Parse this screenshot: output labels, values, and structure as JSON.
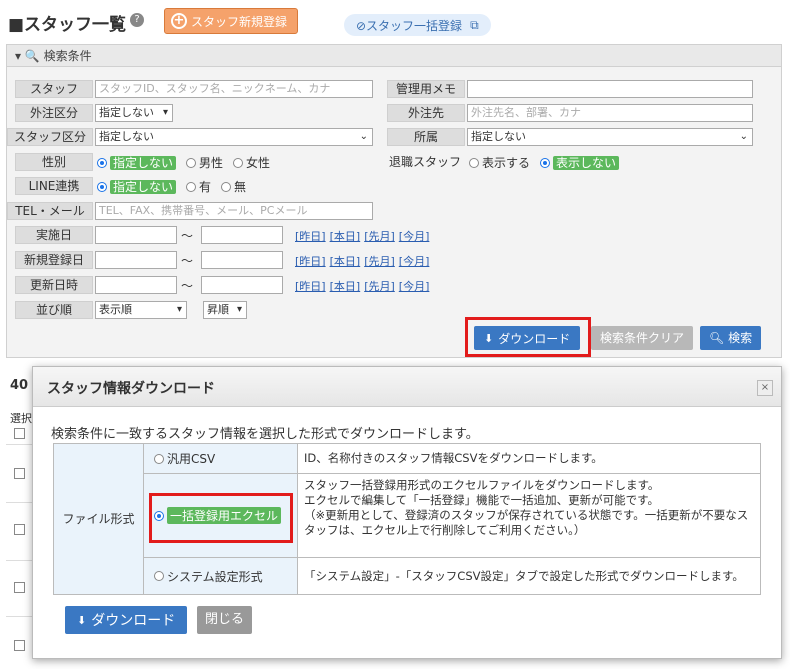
{
  "header": {
    "title": "■スタッフ一覧",
    "help": "?",
    "new_button": "スタッフ新規登録",
    "bulk_button": "⊘スタッフ一括登録"
  },
  "search": {
    "title": "▾ 🔍 検索条件",
    "labels": {
      "staff": "スタッフ",
      "memo": "管理用メモ",
      "outsource_type": "外注区分",
      "outsource_to": "外注先",
      "staff_type": "スタッフ区分",
      "affiliation": "所属",
      "gender": "性別",
      "retired": "退職スタッフ",
      "line": "LINE連携",
      "tel": "TEL・メール",
      "exec_date": "実施日",
      "reg_date": "新規登録日",
      "upd_date": "更新日時",
      "order": "並び順"
    },
    "placeholders": {
      "staff": "スタッフID、スタッフ名、ニックネーム、カナ",
      "outsource_to": "外注先名、部署、カナ",
      "tel": "TEL、FAX、携帯番号、メール、PCメール"
    },
    "values": {
      "outsource_type": "指定しない",
      "staff_type": "指定しない",
      "affiliation": "指定しない",
      "order": "表示順",
      "direction": "昇順"
    },
    "gender_options": [
      "指定しない",
      "男性",
      "女性"
    ],
    "retired_options": [
      "表示する",
      "表示しない"
    ],
    "line_options": [
      "指定しない",
      "有",
      "無"
    ],
    "tilde": "〜",
    "date_links": [
      "[昨日]",
      "[本日]",
      "[先月]",
      "[今月]"
    ],
    "download": "ダウンロード",
    "clear": "検索条件クリア",
    "search_button": "検索"
  },
  "list": {
    "count": "40",
    "select_col": "選択"
  },
  "modal": {
    "title": "スタッフ情報ダウンロード",
    "close_x": "×",
    "description": "検索条件に一致するスタッフ情報を選択した形式でダウンロードします。",
    "format_label": "ファイル形式",
    "options": [
      {
        "label": "汎用CSV",
        "selected": false,
        "desc": "ID、名称付きのスタッフ情報CSVをダウンロードします。"
      },
      {
        "label": "一括登録用エクセル",
        "selected": true,
        "desc": "スタッフ一括登録用形式のエクセルファイルをダウンロードします。\nエクセルで編集して「一括登録」機能で一括追加、更新が可能です。\n（※更新用として、登録済のスタッフが保存されている状態です。一括更新が不要なスタッフは、エクセル上で行削除してご利用ください。）"
      },
      {
        "label": "システム設定形式",
        "selected": false,
        "desc": "「システム設定」-「スタッフCSV設定」タブで設定した形式でダウンロードします。"
      }
    ],
    "download_button": "ダウンロード",
    "close_button": "閉じる"
  },
  "colors": {
    "accent": "#3a78c3",
    "highlight": "#e21b1b",
    "green": "#5cb85c",
    "orange": "#f5a26b"
  }
}
